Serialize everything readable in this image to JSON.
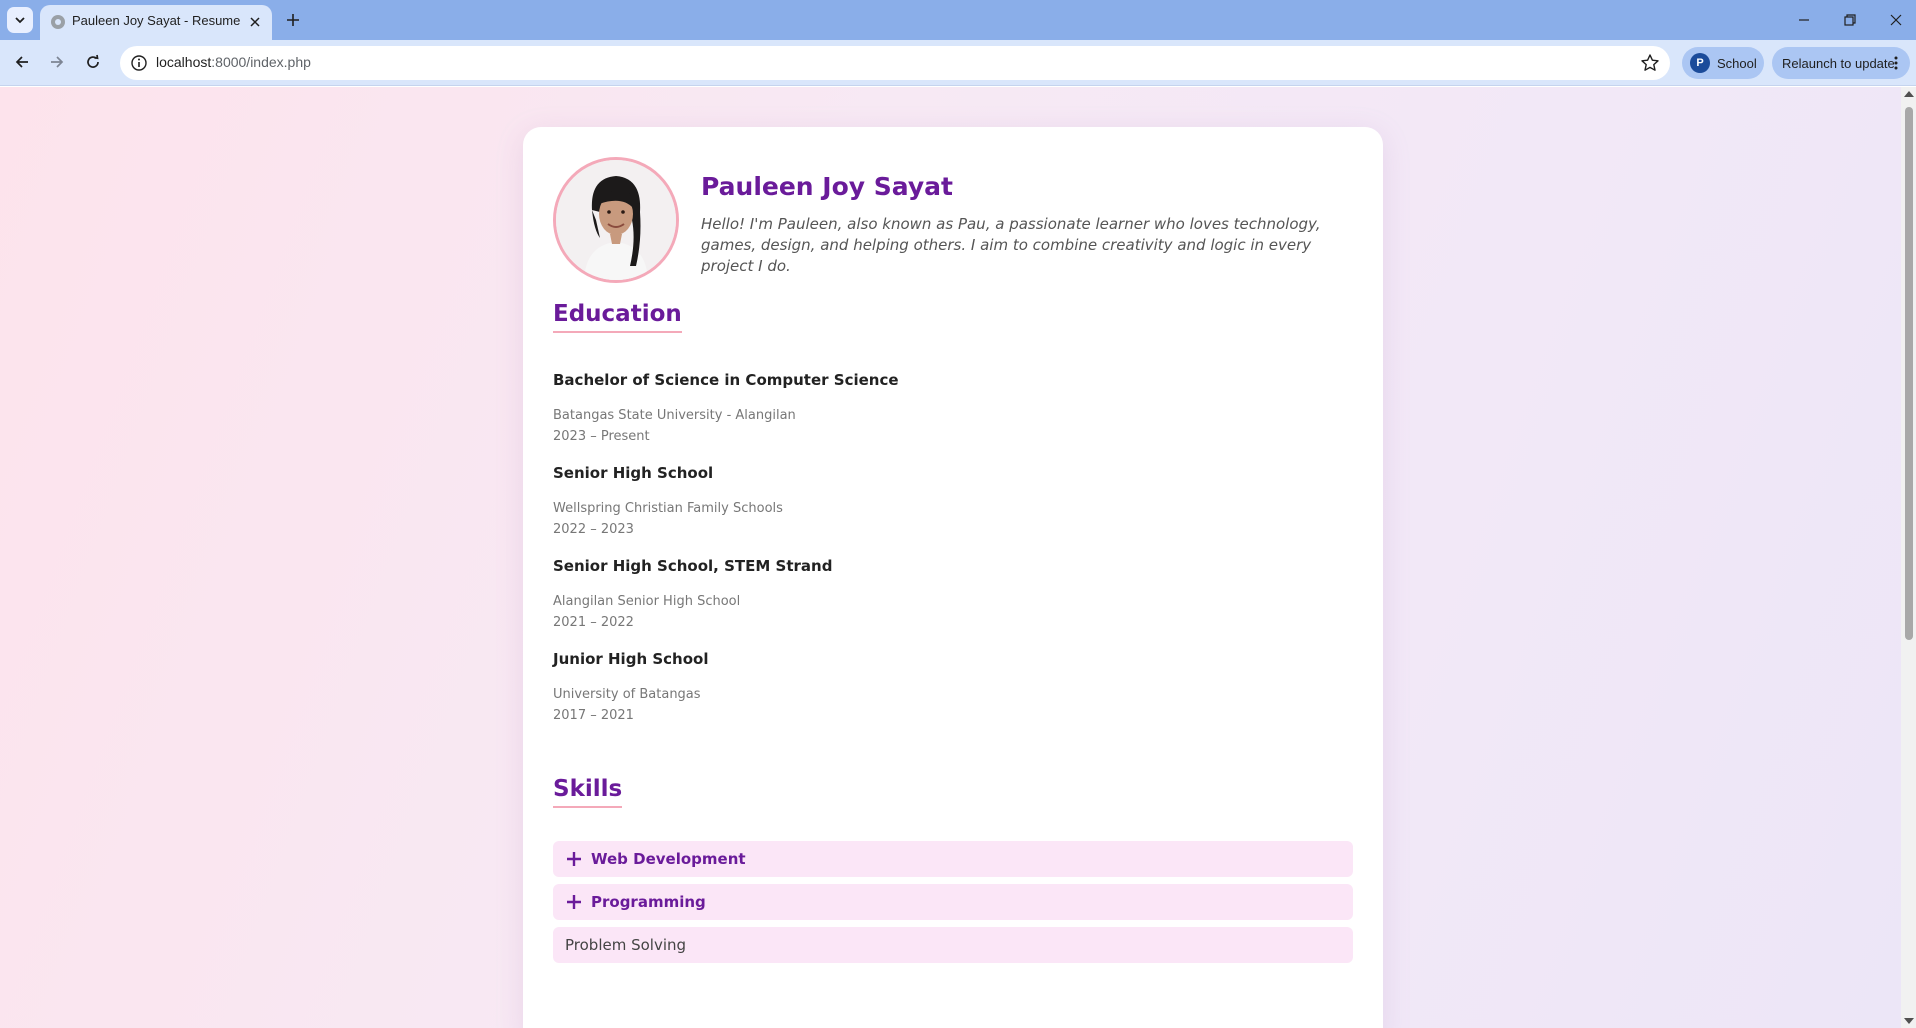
{
  "browser": {
    "tab_title": "Pauleen Joy Sayat - Resume",
    "url_host": "localhost",
    "url_rest": ":8000/index.php",
    "profile_initial": "P",
    "profile_name": "School",
    "relaunch_label": "Relaunch to update"
  },
  "resume": {
    "name": "Pauleen Joy Sayat",
    "bio": "Hello! I'm Pauleen, also known as Pau, a passionate learner who loves technology, games, design, and helping others. I aim to combine creativity and logic in every project I do.",
    "education_title": "Education",
    "education": [
      {
        "degree": "Bachelor of Science in Computer Science",
        "school": "Batangas State University - Alangilan",
        "years": "2023 – Present"
      },
      {
        "degree": "Senior High School",
        "school": "Wellspring Christian Family Schools",
        "years": "2022 – 2023"
      },
      {
        "degree": "Senior High School, STEM Strand",
        "school": "Alangilan Senior High School",
        "years": "2021 – 2022"
      },
      {
        "degree": "Junior High School",
        "school": "University of Batangas",
        "years": "2017 – 2021"
      }
    ],
    "skills_title": "Skills",
    "skills": [
      {
        "label": "Web Development",
        "expandable": true
      },
      {
        "label": "Programming",
        "expandable": true
      },
      {
        "label": "Problem Solving",
        "expandable": false
      }
    ]
  },
  "colors": {
    "accent": "#6a1b9a",
    "underline": "#f4a9b9",
    "skill_bg": "#fbe6f7",
    "tabstrip": "#8aaee9"
  }
}
